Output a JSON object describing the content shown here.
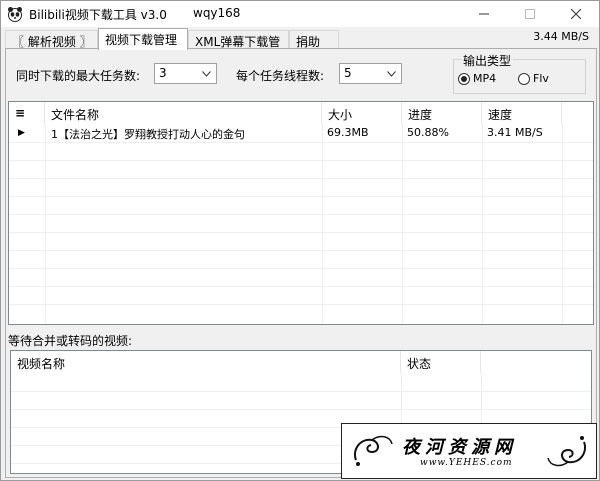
{
  "window": {
    "title": "Bilibili视频下载工具 v3.0",
    "user": "wqy168"
  },
  "tabs": [
    {
      "label": "〖 解析视频 〗"
    },
    {
      "label": "视频下载管理"
    },
    {
      "label": "XML弹幕下载管理"
    },
    {
      "label": "捐助"
    }
  ],
  "total_speed": "3.44 MB/S",
  "settings": {
    "max_tasks_label": "同时下载的最大任务数:",
    "max_tasks_value": "3",
    "threads_label": "每个任务线程数:",
    "threads_value": "5"
  },
  "output_type": {
    "title": "输出类型",
    "options": [
      {
        "label": "MP4",
        "checked": true
      },
      {
        "label": "Flv",
        "checked": false
      }
    ]
  },
  "download_table": {
    "menu_icon": "≡",
    "headers": [
      "文件名称",
      "大小",
      "进度",
      "速度"
    ],
    "rows": [
      {
        "marker": "▶",
        "name": "1【法治之光】罗翔教授打动人心的金句",
        "size": "69.3MB",
        "progress": "50.88%",
        "speed": "3.41 MB/S"
      }
    ]
  },
  "merge_section": {
    "label": "等待合并或转码的视频:",
    "headers": [
      "视频名称",
      "状态"
    ]
  },
  "watermark": {
    "text": "夜河资源网",
    "url": "www.YEHES.com"
  }
}
